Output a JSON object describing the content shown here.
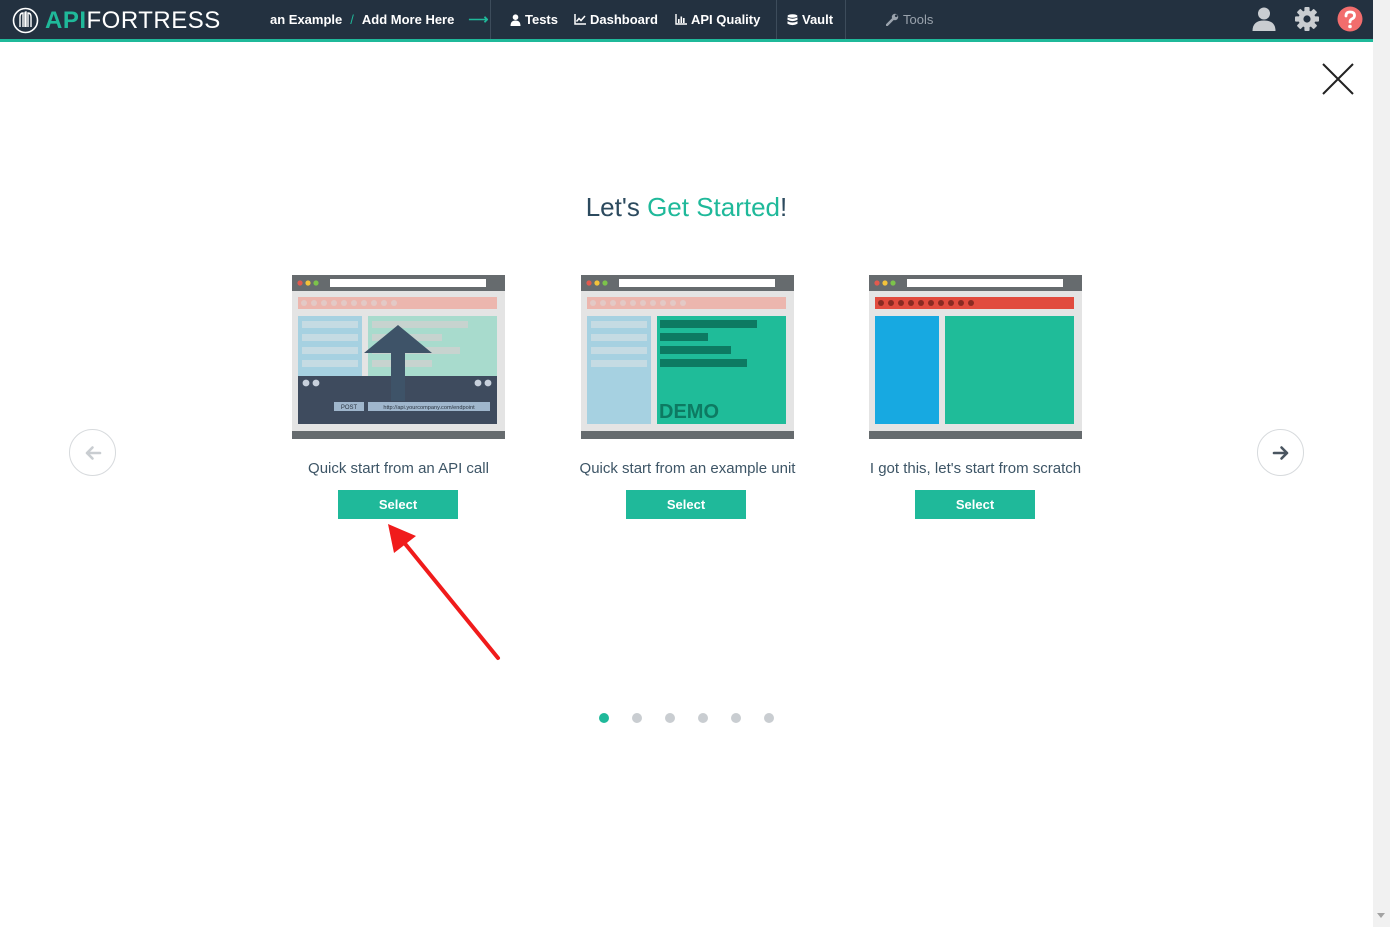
{
  "navbar": {
    "logo": {
      "api": "API",
      "fortress": "FORTRESS"
    },
    "breadcrumb": {
      "project": "an Example",
      "separator": "/",
      "current": "Add More Here"
    },
    "links": [
      {
        "label": "Tests",
        "icon": "user-icon"
      },
      {
        "label": "Dashboard",
        "icon": "line-chart-icon"
      },
      {
        "label": "API Quality",
        "icon": "bar-chart-icon"
      },
      {
        "label": "Vault",
        "icon": "database-icon"
      },
      {
        "label": "Tools",
        "icon": "wrench-icon"
      }
    ],
    "right_icons": [
      "user-profile-icon",
      "gear-icon",
      "help-icon"
    ]
  },
  "modal": {
    "heading_prefix": "Let's ",
    "heading_accent": "Get Started",
    "heading_suffix": "!",
    "options": [
      {
        "caption": "Quick start from an API call",
        "button": "Select",
        "illustration": {
          "method": "POST",
          "url": "http://api.yourcompany.com/endpoint"
        }
      },
      {
        "caption": "Quick start from an example unit",
        "button": "Select",
        "illustration": {
          "label": "DEMO"
        }
      },
      {
        "caption": "I got this, let's start from scratch",
        "button": "Select"
      }
    ],
    "carousel": {
      "pages": 6,
      "active": 1
    }
  },
  "colors": {
    "accent": "#1fb99a",
    "navbar": "#233140",
    "annotation_arrow": "#f01b1b"
  }
}
